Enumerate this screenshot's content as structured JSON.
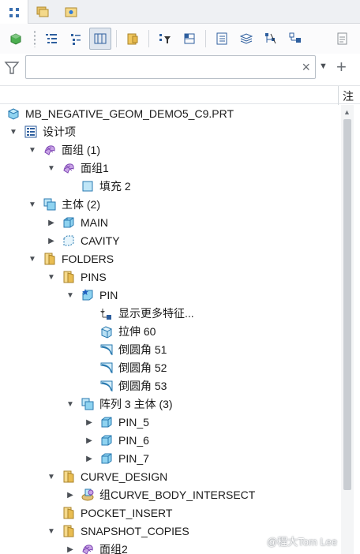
{
  "header": {
    "column_label": "注"
  },
  "filter": {
    "value": "",
    "placeholder": "",
    "clear_glyph": "×",
    "dropdown_glyph": "▼",
    "add_glyph": "+"
  },
  "tree": {
    "rows": [
      {
        "label": "MB_NEGATIVE_GEOM_DEMO5_C9.PRT",
        "icon": "part-icon",
        "twisty": "none"
      },
      {
        "label": "设计项",
        "icon": "design-items-icon",
        "twisty": "expanded"
      },
      {
        "label": "面组 (1)",
        "icon": "quilt-icon",
        "twisty": "expanded"
      },
      {
        "label": "面组1",
        "icon": "quilt-icon",
        "twisty": "expanded"
      },
      {
        "label": "填充 2",
        "icon": "fill-icon",
        "twisty": "none"
      },
      {
        "label": "主体 (2)",
        "icon": "bodies-icon",
        "twisty": "expanded"
      },
      {
        "label": "MAIN",
        "icon": "body-icon",
        "twisty": "collapsed"
      },
      {
        "label": "CAVITY",
        "icon": "cavity-body-icon",
        "twisty": "collapsed"
      },
      {
        "label": "FOLDERS",
        "icon": "folder-icon",
        "twisty": "expanded"
      },
      {
        "label": "PINS",
        "icon": "folder-icon",
        "twisty": "expanded"
      },
      {
        "label": "PIN",
        "icon": "body-star-icon",
        "twisty": "expanded"
      },
      {
        "label": "显示更多特征...",
        "icon": "show-more-icon",
        "twisty": "none"
      },
      {
        "label": "拉伸 60",
        "icon": "extrude-icon",
        "twisty": "none"
      },
      {
        "label": "倒圆角 51",
        "icon": "round-icon",
        "twisty": "none"
      },
      {
        "label": "倒圆角 52",
        "icon": "round-icon",
        "twisty": "none"
      },
      {
        "label": "倒圆角 53",
        "icon": "round-icon",
        "twisty": "none"
      },
      {
        "label": "阵列 3 主体 (3)",
        "icon": "pattern-bodies-icon",
        "twisty": "expanded"
      },
      {
        "label": "PIN_5",
        "icon": "body-icon",
        "twisty": "collapsed"
      },
      {
        "label": "PIN_6",
        "icon": "body-icon",
        "twisty": "collapsed"
      },
      {
        "label": "PIN_7",
        "icon": "body-icon",
        "twisty": "collapsed"
      },
      {
        "label": "CURVE_DESIGN",
        "icon": "folder-icon",
        "twisty": "expanded"
      },
      {
        "label": "组CURVE_BODY_INTERSECT",
        "icon": "group-icon",
        "twisty": "collapsed"
      },
      {
        "label": "POCKET_INSERT",
        "icon": "folder-icon",
        "twisty": "none"
      },
      {
        "label": "SNAPSHOT_COPIES",
        "icon": "folder-icon",
        "twisty": "expanded"
      },
      {
        "label": "面组2",
        "icon": "quilt-icon",
        "twisty": "collapsed"
      }
    ]
  },
  "watermark": "@程大Tom Lee"
}
